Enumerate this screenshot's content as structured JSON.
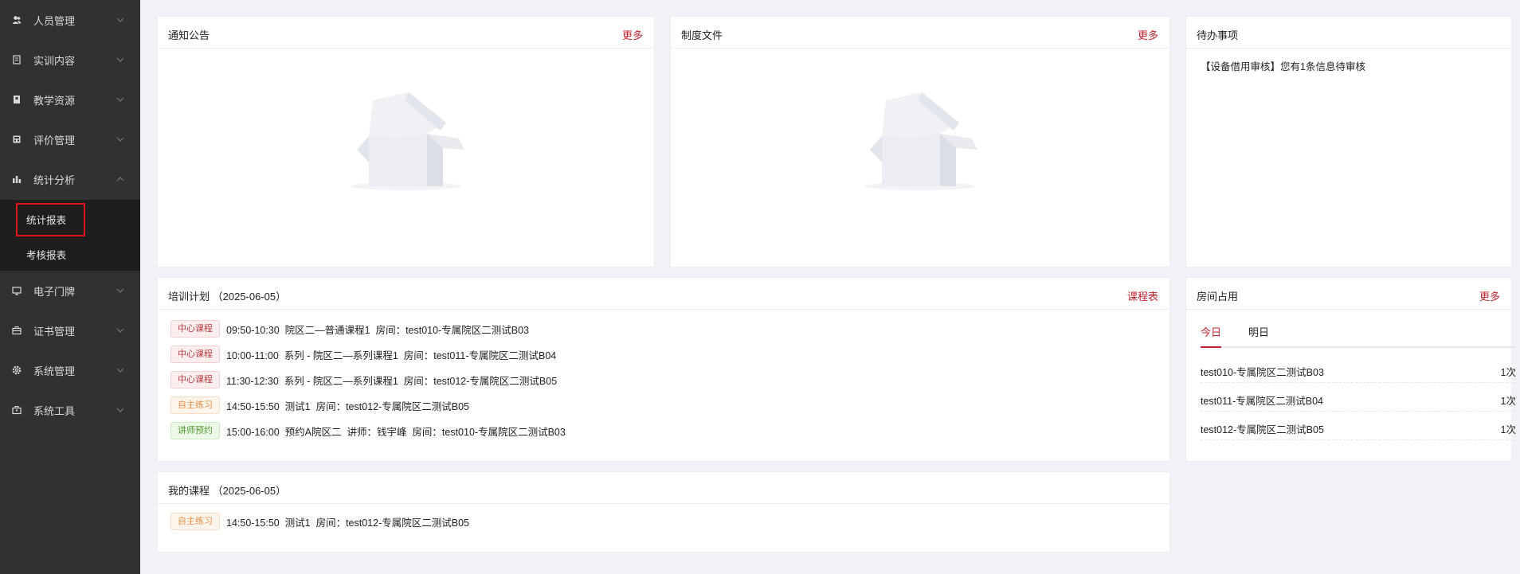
{
  "sidebar": {
    "menu": [
      {
        "label": "人员管理",
        "icon": "user-group-icon",
        "expanded": false
      },
      {
        "label": "实训内容",
        "icon": "document-list-icon",
        "expanded": false
      },
      {
        "label": "教学资源",
        "icon": "book-icon",
        "expanded": false
      },
      {
        "label": "评价管理",
        "icon": "calculator-icon",
        "expanded": false
      },
      {
        "label": "统计分析",
        "icon": "bar-chart-icon",
        "expanded": true
      },
      {
        "label": "电子门牌",
        "icon": "monitor-icon",
        "expanded": false
      },
      {
        "label": "证书管理",
        "icon": "briefcase-icon",
        "expanded": false
      },
      {
        "label": "系统管理",
        "icon": "gear-icon",
        "expanded": false
      },
      {
        "label": "系统工具",
        "icon": "toolbox-icon",
        "expanded": false
      }
    ],
    "submenu": [
      {
        "label": "统计报表",
        "selected": true
      },
      {
        "label": "考核报表",
        "selected": false
      }
    ]
  },
  "notice": {
    "title": "通知公告",
    "more": "更多"
  },
  "policy": {
    "title": "制度文件",
    "more": "更多"
  },
  "todo": {
    "title": "待办事项",
    "items": [
      "【设备借用审核】您有1条信息待审核"
    ]
  },
  "training": {
    "title": "培训计划",
    "date": "（2025-06-05）",
    "more": "课程表",
    "rows": [
      {
        "tag": "中心课程",
        "tag_type": "center",
        "text": "09:50-10:30  院区二—普通课程1  房间：test010-专属院区二测试B03"
      },
      {
        "tag": "中心课程",
        "tag_type": "center",
        "text": "10:00-11:00  系列 - 院区二—系列课程1  房间：test011-专属院区二测试B04"
      },
      {
        "tag": "中心课程",
        "tag_type": "center",
        "text": "11:30-12:30  系列 - 院区二—系列课程1  房间：test012-专属院区二测试B05"
      },
      {
        "tag": "自主练习",
        "tag_type": "self",
        "text": "14:50-15:50  测试1  房间：test012-专属院区二测试B05"
      },
      {
        "tag": "讲师预约",
        "tag_type": "lecturer",
        "text": "15:00-16:00  预约A院区二  讲师：钱宇峰  房间：test010-专属院区二测试B03"
      }
    ]
  },
  "room": {
    "title": "房间占用",
    "more": "更多",
    "tabs": [
      "今日",
      "明日"
    ],
    "active_tab": 0,
    "rows": [
      {
        "name": "test010-专属院区二测试B03",
        "count": "1次"
      },
      {
        "name": "test011-专属院区二测试B04",
        "count": "1次"
      },
      {
        "name": "test012-专属院区二测试B05",
        "count": "1次"
      }
    ]
  },
  "my_courses": {
    "title": "我的课程",
    "date": "（2025-06-05）",
    "rows": [
      {
        "tag": "自主练习",
        "tag_type": "self",
        "text": "14:50-15:50  测试1  房间：test012-专属院区二测试B05"
      }
    ]
  },
  "colors": {
    "accent": "#c0242e",
    "sidebar": "#303133",
    "submenu": "#1e1e1e",
    "highlight": "#e0151b"
  }
}
